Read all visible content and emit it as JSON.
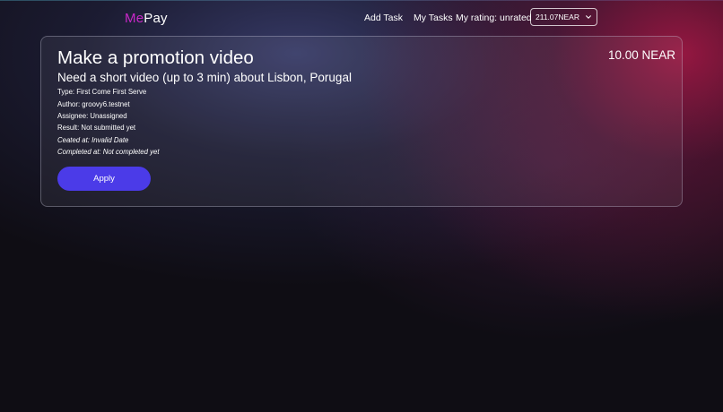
{
  "header": {
    "logo_primary": "Me",
    "logo_secondary": "Pay",
    "nav": {
      "add_task": "Add Task",
      "my_tasks": "My Tasks",
      "rating": "My rating: unrated"
    },
    "balance": "211.07NEAR",
    "balance_icon": "chevron-down-icon"
  },
  "task": {
    "title": "Make a promotion video",
    "price": "10.00 NEAR",
    "description": "Need a short video (up to 3 min) about Lisbon, Porugal",
    "type": "Type: First Come First Serve",
    "author": "Author: groovy6.testnet",
    "assignee": "Assignee: Unassigned",
    "result": "Result: Not submitted yet",
    "created": "Ceated at: Invalid Date",
    "completed": "Completed at: Not completed yet",
    "apply_label": "Apply"
  },
  "colors": {
    "background": "#0f0d14",
    "logo_accent": "#c828c8",
    "apply_button": "#4b3be8"
  }
}
